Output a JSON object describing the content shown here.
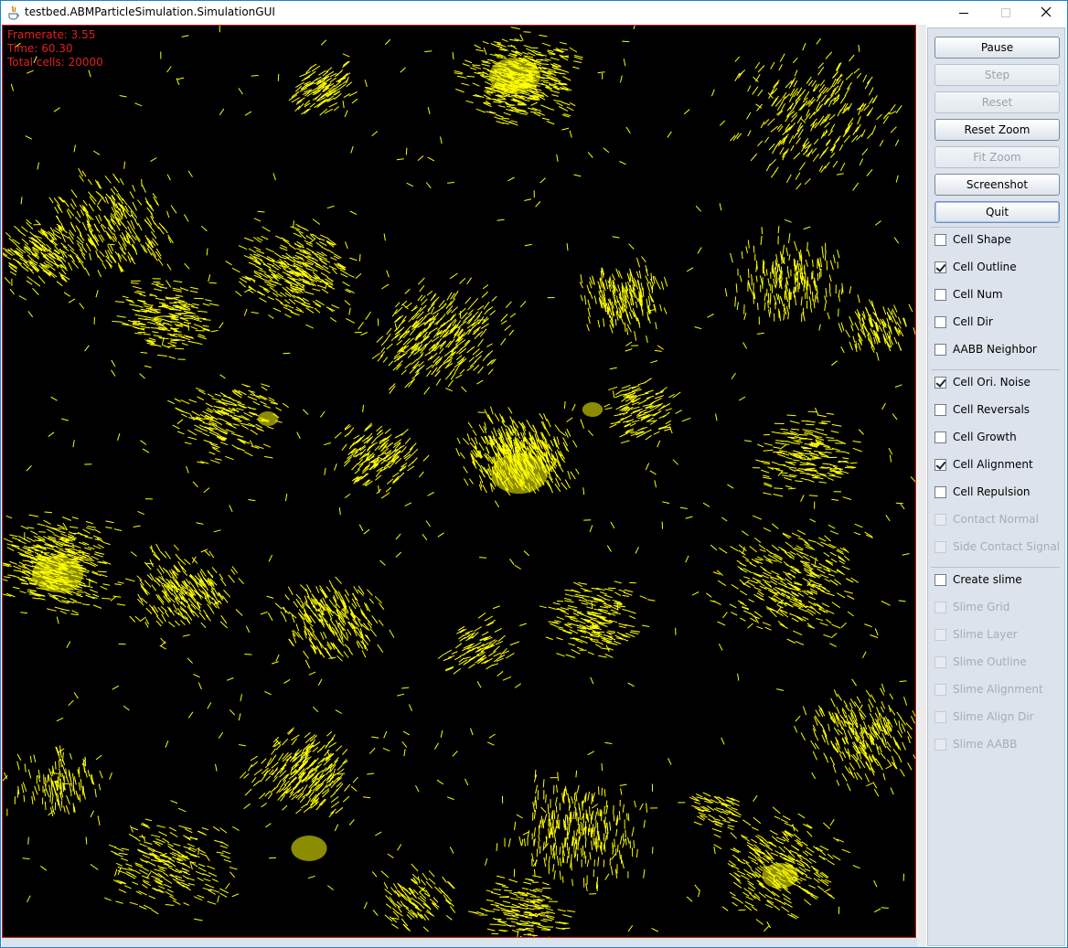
{
  "window": {
    "title": "testbed.ABMParticleSimulation.SimulationGUI",
    "accent": "#1883d7"
  },
  "canvas": {
    "background": "#000000",
    "cell_color": "#ffff00",
    "overlay_color": "#e02020",
    "overlay": [
      "Framerate: 3.55",
      "Time: 60.30",
      "Total cells: 20000"
    ]
  },
  "controls": {
    "buttons": [
      {
        "id": "pause",
        "label": "Pause",
        "enabled": true
      },
      {
        "id": "step",
        "label": "Step",
        "enabled": false
      },
      {
        "id": "reset",
        "label": "Reset",
        "enabled": false
      },
      {
        "id": "reset-zoom",
        "label": "Reset Zoom",
        "enabled": true
      },
      {
        "id": "fit-zoom",
        "label": "Fit Zoom",
        "enabled": false
      },
      {
        "id": "screenshot",
        "label": "Screenshot",
        "enabled": true
      },
      {
        "id": "quit",
        "label": "Quit",
        "enabled": true,
        "focused": true
      }
    ],
    "checkbox_groups": [
      [
        {
          "id": "cell-shape",
          "label": "Cell Shape",
          "checked": false,
          "enabled": true
        },
        {
          "id": "cell-outline",
          "label": "Cell Outline",
          "checked": true,
          "enabled": true
        },
        {
          "id": "cell-num",
          "label": "Cell Num",
          "checked": false,
          "enabled": true
        },
        {
          "id": "cell-dir",
          "label": "Cell Dir",
          "checked": false,
          "enabled": true
        },
        {
          "id": "aabb-neighbor",
          "label": "AABB Neighbor",
          "checked": false,
          "enabled": true
        }
      ],
      [
        {
          "id": "cell-ori-noise",
          "label": "Cell Ori. Noise",
          "checked": true,
          "enabled": true
        },
        {
          "id": "cell-reversals",
          "label": "Cell Reversals",
          "checked": false,
          "enabled": true
        },
        {
          "id": "cell-growth",
          "label": "Cell Growth",
          "checked": false,
          "enabled": true
        },
        {
          "id": "cell-alignment",
          "label": "Cell Alignment",
          "checked": true,
          "enabled": true
        },
        {
          "id": "cell-repulsion",
          "label": "Cell Repulsion",
          "checked": false,
          "enabled": true
        },
        {
          "id": "contact-normal",
          "label": "Contact Normal",
          "checked": false,
          "enabled": false
        },
        {
          "id": "side-contact-signal",
          "label": "Side Contact Signal",
          "checked": false,
          "enabled": false
        }
      ],
      [
        {
          "id": "create-slime",
          "label": "Create slime",
          "checked": false,
          "enabled": true
        },
        {
          "id": "slime-grid",
          "label": "Slime Grid",
          "checked": false,
          "enabled": false
        },
        {
          "id": "slime-layer",
          "label": "Slime Layer",
          "checked": false,
          "enabled": false
        },
        {
          "id": "slime-outline",
          "label": "Slime Outline",
          "checked": false,
          "enabled": false
        },
        {
          "id": "slime-alignment",
          "label": "Slime Alignment",
          "checked": false,
          "enabled": false
        },
        {
          "id": "slime-align-dir",
          "label": "Slime Align Dir",
          "checked": false,
          "enabled": false
        },
        {
          "id": "slime-aabb",
          "label": "Slime AABB",
          "checked": false,
          "enabled": false
        }
      ]
    ]
  }
}
